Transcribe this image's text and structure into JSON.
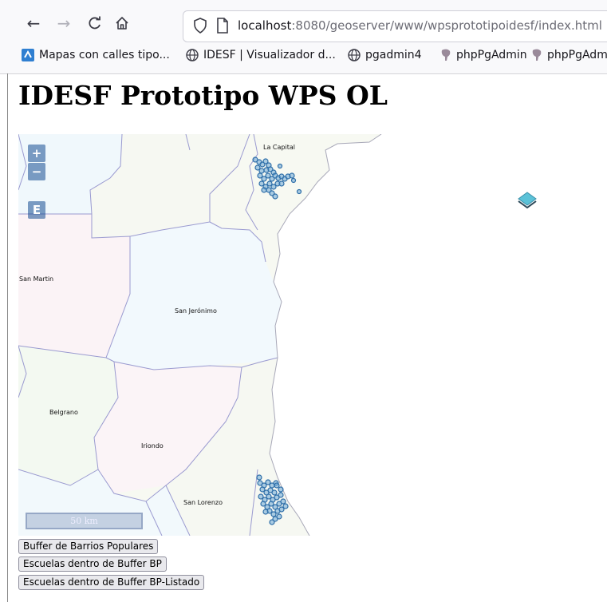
{
  "browser": {
    "nav": {
      "back": "←",
      "forward": "→",
      "reload": "C",
      "home": "⌂"
    },
    "url": {
      "host": "localhost",
      "rest": ":8080/geoserver/www/wpsprototipoidesf/index.html"
    },
    "bookmarks": [
      {
        "label": "Mapas con calles tipo...",
        "icon": "map-icon"
      },
      {
        "label": "IDESF | Visualizador d...",
        "icon": "globe-icon"
      },
      {
        "label": "pgadmin4",
        "icon": "globe-icon"
      },
      {
        "label": "phpPgAdmin",
        "icon": "elephant-icon"
      },
      {
        "label": "phpPgAdmi",
        "icon": "elephant-icon"
      }
    ]
  },
  "page": {
    "title": "IDESF Prototipo WPS OL"
  },
  "map": {
    "zoom_in": "+",
    "zoom_out": "−",
    "extent_btn": "E",
    "scale": "50 km",
    "labels": {
      "la_capital": "La Capital",
      "san_martin": "San Martin",
      "san_jeronimo": "San Jerónimo",
      "belgrano": "Belgrano",
      "iriondo": "Iriondo",
      "san_lorenzo": "San Lorenzo"
    },
    "colors": {
      "water": "#ffffff",
      "dept_border": "#9a9ad0",
      "point_fill": "#6aa5d6",
      "point_stroke": "#2e6ea8"
    }
  },
  "actions": {
    "buffer_barrios": "Buffer de Barrios Populares",
    "escuelas_buffer": "Escuelas dentro de Buffer BP",
    "escuelas_listado": "Escuelas dentro de Buffer BP-Listado"
  }
}
